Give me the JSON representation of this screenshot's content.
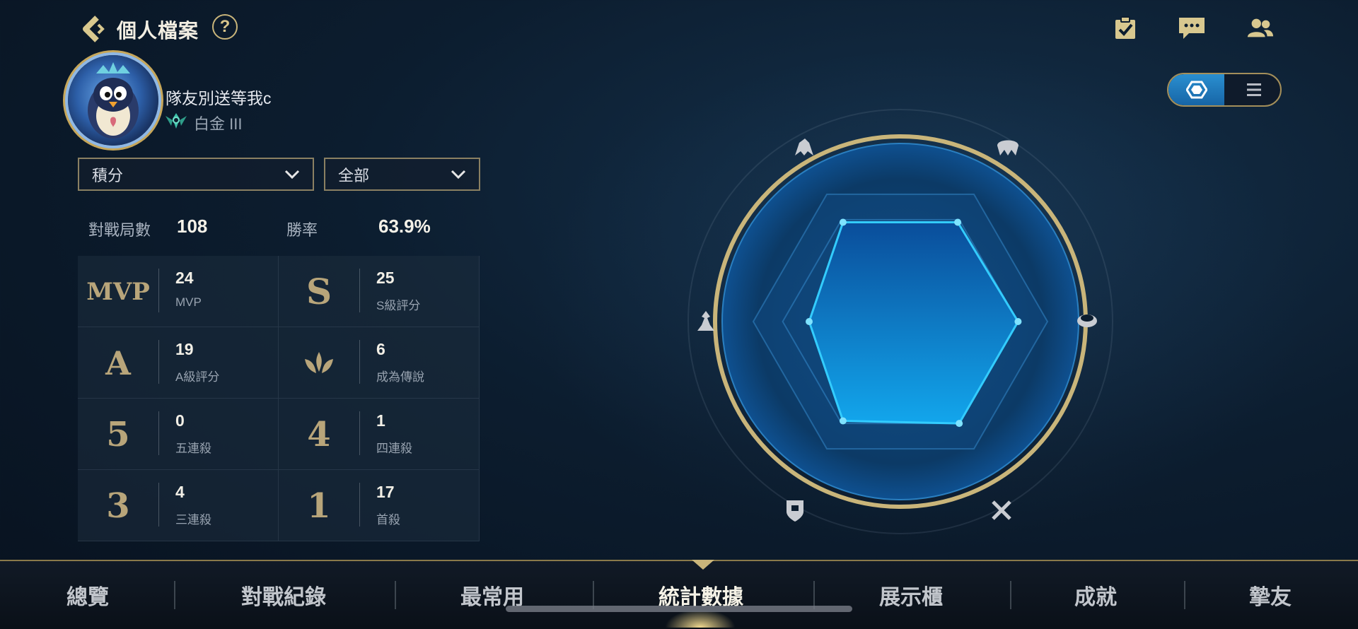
{
  "header": {
    "title": "個人檔案",
    "help_label": "?"
  },
  "profile": {
    "name": "隊友別送等我c",
    "rank": "白金 III"
  },
  "filters": {
    "mode": "積分",
    "scope": "全部"
  },
  "summary": {
    "matches_label": "對戰局數",
    "matches_value": "108",
    "winrate_label": "勝率",
    "winrate_value": "63.9%"
  },
  "stats": [
    {
      "badge": "MVP",
      "value": "24",
      "label": "MVP"
    },
    {
      "badge": "S",
      "value": "25",
      "label": "S級評分"
    },
    {
      "badge": "A",
      "value": "19",
      "label": "A級評分"
    },
    {
      "badge": "legend",
      "value": "6",
      "label": "成為傳說"
    },
    {
      "badge": "5",
      "value": "0",
      "label": "五連殺"
    },
    {
      "badge": "4",
      "value": "1",
      "label": "四連殺"
    },
    {
      "badge": "3",
      "value": "4",
      "label": "三連殺"
    },
    {
      "badge": "1",
      "value": "17",
      "label": "首殺"
    }
  ],
  "radar": {
    "axes": [
      "warrior-icon",
      "tank-helmet-icon",
      "mage-icon",
      "marksman-icon",
      "support-shield-icon",
      "assassin-icon"
    ],
    "values": [
      0.78,
      0.78,
      0.8,
      0.8,
      0.78,
      0.62
    ]
  },
  "view_toggle": {
    "active": "radar-icon",
    "inactive": "list-icon"
  },
  "top_icons": [
    "clipboard-check-icon",
    "chat-icon",
    "friends-icon"
  ],
  "nav": {
    "tabs": [
      "總覽",
      "對戰紀錄",
      "最常用",
      "統計數據",
      "展示櫃",
      "成就",
      "摯友"
    ],
    "active_index": 3
  },
  "colors": {
    "accent_gold": "#c9b57a",
    "radar_blue": "#29b8ff",
    "radar_fill": "#0a86d8"
  }
}
